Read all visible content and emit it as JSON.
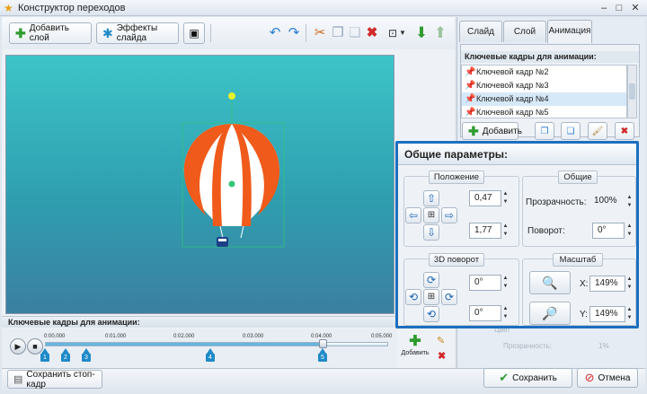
{
  "window": {
    "title": "Конструктор переходов",
    "controls": [
      "–",
      "□",
      "✕"
    ]
  },
  "toolbar": {
    "add_layer": "Добавить слой",
    "slide_effects": "Эффекты слайда",
    "icons": [
      "video-icon",
      "undo-icon",
      "redo-icon",
      "cut-icon",
      "copy-icon",
      "paste-icon",
      "delete-icon",
      "fit-icon",
      "dropdown-icon",
      "move-down-icon",
      "move-up-icon"
    ]
  },
  "timeline": {
    "label": "Ключевые кадры для анимации:",
    "ticks": [
      "0:00.000",
      "0:01.000",
      "0:02.000",
      "0:03.000",
      "0:04.000",
      "0:05.000"
    ],
    "markers": [
      "1",
      "2",
      "3",
      "4",
      "5"
    ],
    "add_label": "Добавить",
    "progress": 0.81
  },
  "bottom": {
    "save_frame": "Сохранить стоп-кадр",
    "save": "Сохранить",
    "cancel": "Отмена"
  },
  "tabs": [
    "Слайд",
    "Слой",
    "Анимация"
  ],
  "active_tab": "Анимация",
  "keyframes_panel": {
    "header": "Ключевые кадры для анимации:",
    "items": [
      "Ключевой кадр №2",
      "Ключевой кадр №3",
      "Ключевой кадр №4",
      "Ключевой кадр №5"
    ],
    "selected_index": 2,
    "add_label": "Добавить"
  },
  "params": {
    "title": "Общие параметры:",
    "position_label": "Положение",
    "pos_x": "0,47",
    "pos_y": "1,77",
    "general_label": "Общие",
    "opacity_label": "Прозрачность:",
    "opacity": "100%",
    "rotation_label": "Поворот:",
    "rotation": "0°",
    "rot3d_label": "3D поворот",
    "rot3d_a": "0°",
    "rot3d_b": "0°",
    "scale_label": "Масштаб",
    "scale_x_label": "X:",
    "scale_x": "149%",
    "scale_y_label": "Y:",
    "scale_y": "149%"
  },
  "behind": {
    "shadow_label": "Цвет",
    "opacity_label": "Прозрачность:",
    "opacity": "1%"
  },
  "colors": {
    "accent": "#1c6fbf",
    "balloon_orange": "#f05a1a",
    "canvas_top": "#3dc4c8"
  }
}
